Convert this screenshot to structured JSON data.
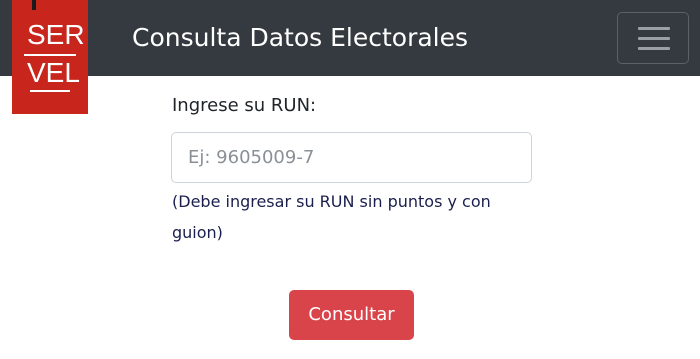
{
  "navbar": {
    "logo": {
      "line1": "SER",
      "line2": "VEL"
    },
    "title": "Consulta Datos Electorales",
    "toggler_icon": "hamburger-menu-icon"
  },
  "form": {
    "label": "Ingrese su RUN:",
    "run_input": {
      "placeholder": "Ej: 9605009-7",
      "value": ""
    },
    "help_text": "(Debe ingresar su RUN sin puntos y con guion)",
    "submit_label": "Consultar"
  },
  "colors": {
    "navbar_bg": "#343a40",
    "logo_bg": "#c8251d",
    "button_bg": "#d9444a",
    "help_text": "#1a1f4d"
  }
}
